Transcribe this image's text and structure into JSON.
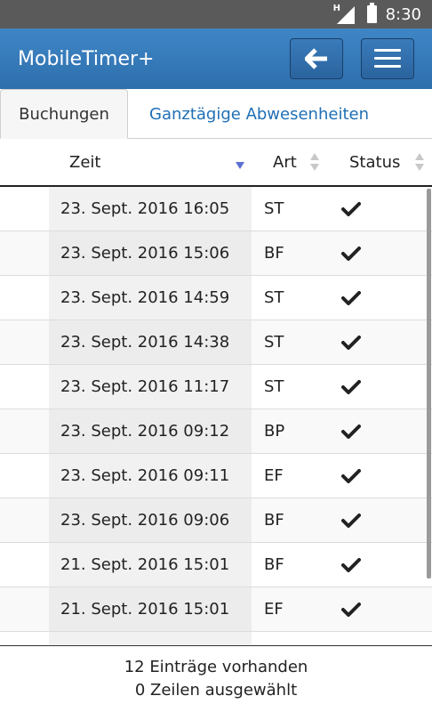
{
  "statusbar": {
    "time": "8:30",
    "network_label": "H"
  },
  "appbar": {
    "title": "MobileTimer+"
  },
  "tabs": [
    {
      "label": "Buchungen",
      "active": true
    },
    {
      "label": "Ganztägige Abwesenheiten",
      "active": false
    }
  ],
  "table": {
    "columns": {
      "zeit": "Zeit",
      "art": "Art",
      "status": "Status"
    },
    "rows": [
      {
        "zeit": "23. Sept. 2016 16:05",
        "art": "ST",
        "status": "check-icon"
      },
      {
        "zeit": "23. Sept. 2016 15:06",
        "art": "BF",
        "status": "check-icon"
      },
      {
        "zeit": "23. Sept. 2016 14:59",
        "art": "ST",
        "status": "check-icon"
      },
      {
        "zeit": "23. Sept. 2016 14:38",
        "art": "ST",
        "status": "check-icon"
      },
      {
        "zeit": "23. Sept. 2016 11:17",
        "art": "ST",
        "status": "check-icon"
      },
      {
        "zeit": "23. Sept. 2016 09:12",
        "art": "BP",
        "status": "check-icon"
      },
      {
        "zeit": "23. Sept. 2016 09:11",
        "art": "EF",
        "status": "check-icon"
      },
      {
        "zeit": "23. Sept. 2016 09:06",
        "art": "BF",
        "status": "check-icon"
      },
      {
        "zeit": "21. Sept. 2016 15:01",
        "art": "BF",
        "status": "check-icon"
      },
      {
        "zeit": "21. Sept. 2016 15:01",
        "art": "EF",
        "status": "check-icon"
      }
    ]
  },
  "footer": {
    "entries_text": "12 Einträge vorhanden",
    "selected_text": "0 Zeilen ausgewählt"
  },
  "colors": {
    "appbar": "#3479b9",
    "tab_link": "#1f6fb5",
    "sort_active": "#5b6fd6"
  }
}
